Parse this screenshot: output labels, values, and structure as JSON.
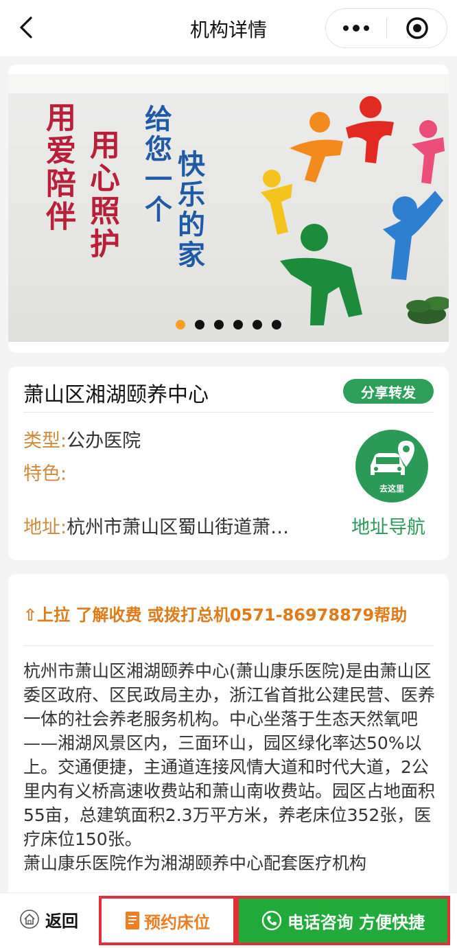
{
  "header": {
    "title": "机构详情"
  },
  "banner": {
    "wall_text": {
      "col1": "用爱陪伴",
      "col2": "用心照护",
      "col3": "给您一个",
      "col4": "快乐的家"
    },
    "dots_total": 6,
    "active_dot": 1
  },
  "institution": {
    "name": "萧山区湘湖颐养中心",
    "share_label": "分享转发",
    "type_label": "类型:",
    "type_value": "公办医院",
    "feature_label": "特色:",
    "feature_value": "",
    "address_label": "地址:",
    "address_value": "杭州市萧山区蜀山街道萧…",
    "go_here_label": "去这里",
    "nav_label": "地址导航"
  },
  "description": {
    "hint": "⇧上拉 了解收费 或拨打总机0571-86978879帮助",
    "paragraph1": "杭州市萧山区湘湖颐养中心(萧山康乐医院)是由萧山区委区政府、区民政局主办，浙江省首批公建民营、医养一体的社会养老服务机构。中心坐落于生态天然氧吧——湘湖风景区内，三面环山，园区绿化率达50%以上。交通便捷，主通道连接风情大道和时代大道，2公里内有义桥高速收费站和萧山南收费站。园区占地面积55亩，总建筑面积2.3万平方米，养老床位352张，医疗床位150张。",
    "paragraph2": "萧山康乐医院作为湘湖颐养中心配套医疗机构"
  },
  "bottom_bar": {
    "return_label": "返回",
    "book_label": "预约床位",
    "call_label": "电话咨询 方便快捷"
  },
  "colors": {
    "accent_green": "#2c9a57",
    "label_orange": "#d08a3a",
    "hint_orange": "#e07b1a",
    "call_green": "#1faa3a",
    "highlight_red": "#e0303a",
    "active_dot": "#f5a020"
  }
}
